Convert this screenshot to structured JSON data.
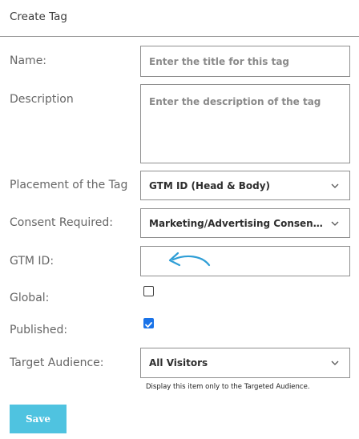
{
  "header": {
    "title": "Create Tag"
  },
  "form": {
    "name": {
      "label": "Name:",
      "placeholder": "Enter the title for this tag"
    },
    "description": {
      "label": "Description",
      "placeholder": "Enter the description of the tag"
    },
    "placement": {
      "label": "Placement of the Tag",
      "value": "GTM ID (Head & Body)"
    },
    "consent": {
      "label": "Consent Required:",
      "value": "Marketing/Advertising Consent R..."
    },
    "gtm_id": {
      "label": "GTM ID:",
      "value": ""
    },
    "global": {
      "label": "Global:",
      "checked": false
    },
    "published": {
      "label": "Published:",
      "checked": true
    },
    "audience": {
      "label": "Target Audience:",
      "value": "All Visitors",
      "hint": "Display this item only to the Targeted Audience."
    }
  },
  "actions": {
    "save_label": "Save"
  },
  "icons": {
    "chevron": "chevron-down-icon",
    "cursor": "undo-arrow-icon"
  },
  "colors": {
    "accent": "#4fc3e0",
    "checkbox": "#1a73e8",
    "cursor_arrow": "#2e9ed6"
  }
}
